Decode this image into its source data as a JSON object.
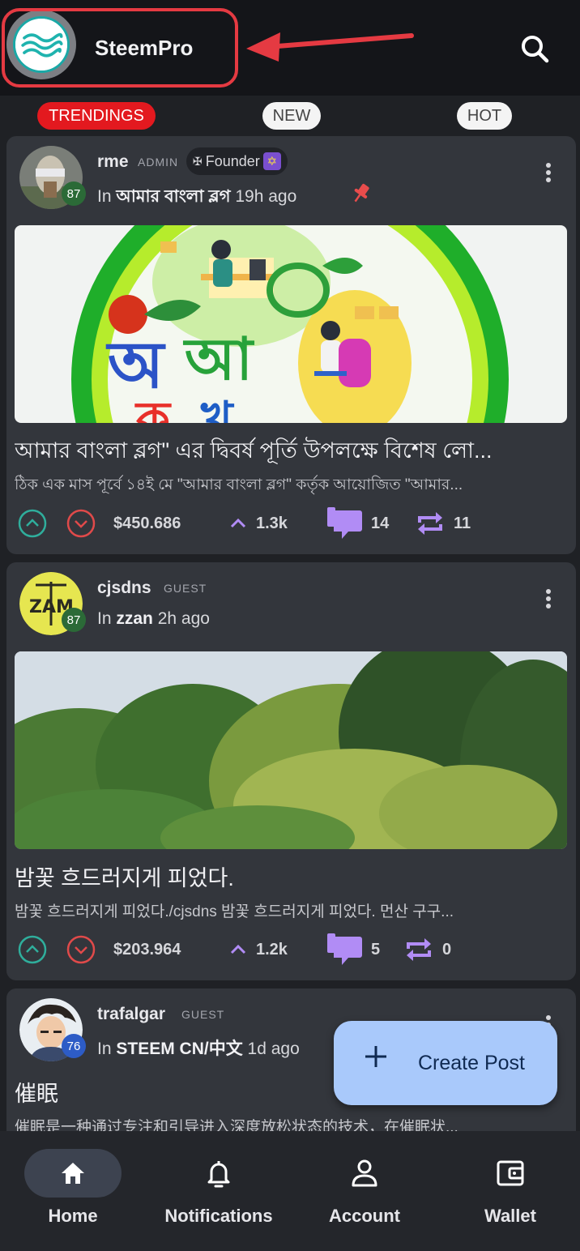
{
  "header": {
    "app_title": "SteemPro",
    "logo_icon": "steempro-wave-logo",
    "search_icon": "search-icon",
    "highlight_color": "#e53a42"
  },
  "tabs": [
    {
      "label": "TRENDINGS",
      "active": true
    },
    {
      "label": "NEW",
      "active": false
    },
    {
      "label": "HOT",
      "active": false
    }
  ],
  "posts": [
    {
      "author": "rme",
      "role": "ADMIN",
      "badge": "Founder",
      "reputation": "87",
      "community_prefix": "In",
      "community": "আমার বাংলা ব্লগ",
      "time": "19h ago",
      "pinned": true,
      "title": "আমার বাংলা ব্লগ\" এর দ্বিবর্ষ পূর্তি উপলক্ষে বিশেষ লো...",
      "body": "ঠিক এক মাস পূর্বে ১৪ই মে \"আমার বাংলা ব্লগ\" কর্তৃক আয়োজিত \"আমার...",
      "payout": "$450.686",
      "votes": "1.3k",
      "comments": "14",
      "resteems": "11"
    },
    {
      "author": "cjsdns",
      "role": "GUEST",
      "reputation": "87",
      "community_prefix": "In",
      "community": "zzan",
      "time": "2h ago",
      "title": "밤꽃 흐드러지게 피었다.",
      "body": "밤꽃 흐드러지게 피었다./cjsdns 밤꽃 흐드러지게 피었다. 먼산 구구...",
      "payout": "$203.964",
      "votes": "1.2k",
      "comments": "5",
      "resteems": "0"
    },
    {
      "author": "trafalgar",
      "role": "GUEST",
      "reputation": "76",
      "community_prefix": "In",
      "community": "STEEM CN/中文",
      "time": "1d ago",
      "title": "催眠",
      "body": "催眠是一种通过专注和引导进入深度放松状态的技术，在催眠状..."
    }
  ],
  "fab": {
    "label": "Create Post"
  },
  "bottom_nav": [
    {
      "label": "Home",
      "icon": "home-icon",
      "active": true
    },
    {
      "label": "Notifications",
      "icon": "bell-icon",
      "active": false
    },
    {
      "label": "Account",
      "icon": "person-icon",
      "active": false
    },
    {
      "label": "Wallet",
      "icon": "wallet-icon",
      "active": false
    }
  ],
  "colors": {
    "upvote": "#2fae9c",
    "downvote": "#e04a4a",
    "accent_purple": "#b18cf5",
    "fab": "#a9c9fb",
    "trending_tab": "#e3191f"
  }
}
